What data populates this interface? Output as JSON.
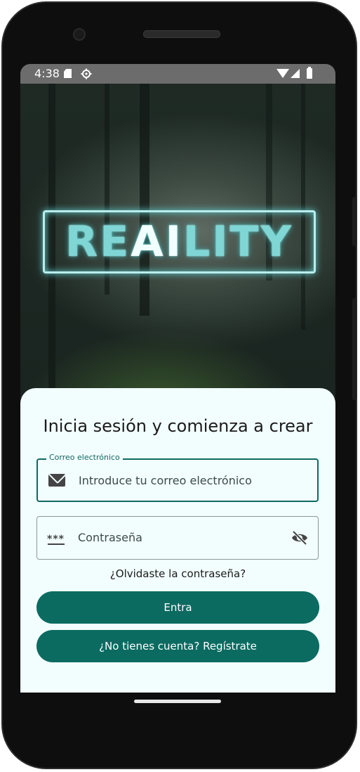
{
  "status_bar": {
    "time": "4:38",
    "icons": [
      "sd-card-icon",
      "settings-gear-icon",
      "wifi-icon",
      "signal-icon",
      "battery-icon"
    ]
  },
  "hero": {
    "logo_text_1": "RE",
    "logo_text_2": "AI",
    "logo_text_3": "LITY",
    "logo_color": "#7fd6d5"
  },
  "login": {
    "title": "Inicia sesión y comienza a crear",
    "email": {
      "label": "Correo electrónico",
      "placeholder": "Introduce tu correo electrónico",
      "icon": "mail-icon"
    },
    "password": {
      "placeholder": "Contraseña",
      "leading_icon": "password-dots-icon",
      "trailing_icon": "visibility-off-icon"
    },
    "forgot_link": "¿Olvidaste la contraseña?",
    "login_button": "Entra",
    "register_button": "¿No tienes cuenta? Regístrate"
  },
  "colors": {
    "primary": "#0b6b61",
    "sheet_background": "#f2fdfd",
    "status_bar": "#6c6c6c"
  }
}
